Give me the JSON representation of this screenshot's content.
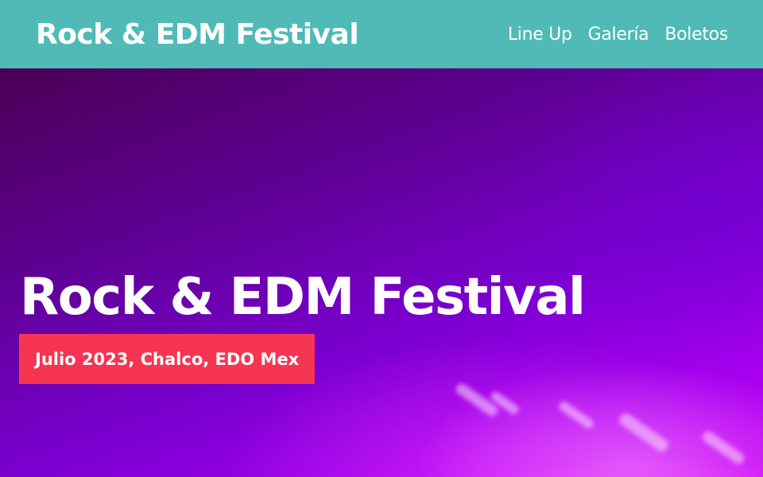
{
  "header": {
    "logo": "Rock & EDM Festival",
    "nav": [
      {
        "label": "Line Up"
      },
      {
        "label": "Galería"
      },
      {
        "label": "Boletos"
      }
    ]
  },
  "hero": {
    "title": "Rock & EDM Festival",
    "badge": "Julio 2023, Chalco, EDO Mex"
  },
  "colors": {
    "header_bg": "#4fbab6",
    "badge_bg": "#f53552",
    "text": "#ffffff"
  }
}
